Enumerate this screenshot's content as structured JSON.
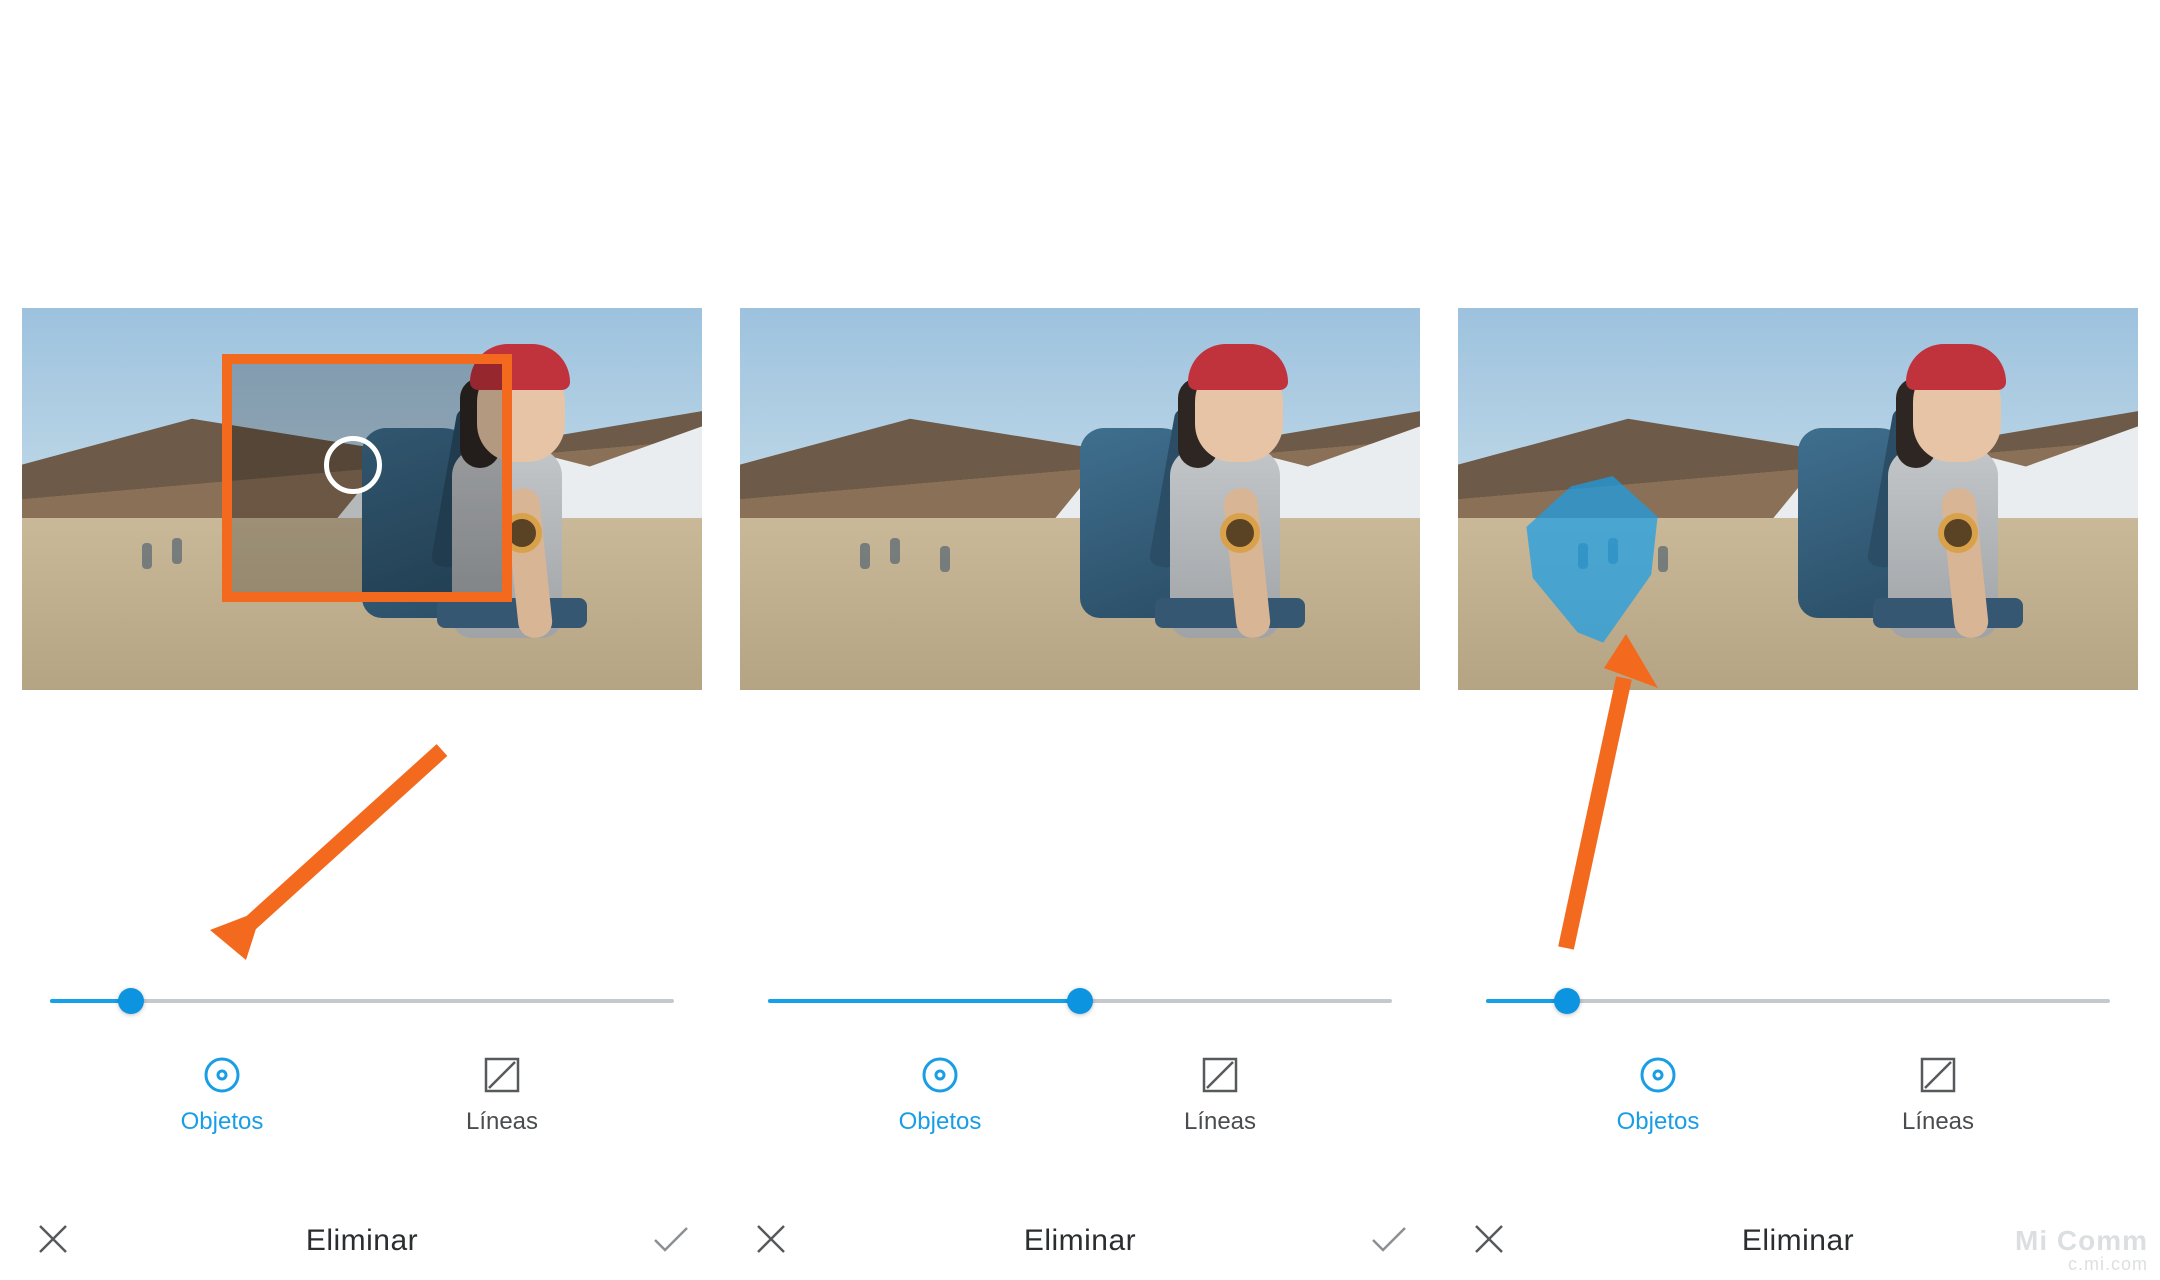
{
  "accent_color": "#199ee6",
  "annotation_color": "#f36a1f",
  "watermark": {
    "line1": "Mi Comm",
    "line2": "c.mi.com"
  },
  "panels": [
    {
      "slider_percent": 13,
      "tools": {
        "objetos": "Objetos",
        "lineas": "Líneas",
        "active": "objetos"
      },
      "title": "Eliminar",
      "show_confirm": true
    },
    {
      "slider_percent": 50,
      "tools": {
        "objetos": "Objetos",
        "lineas": "Líneas",
        "active": "objetos"
      },
      "title": "Eliminar",
      "show_confirm": true
    },
    {
      "slider_percent": 13,
      "tools": {
        "objetos": "Objetos",
        "lineas": "Líneas",
        "active": "objetos"
      },
      "title": "Eliminar",
      "show_confirm": false
    }
  ]
}
